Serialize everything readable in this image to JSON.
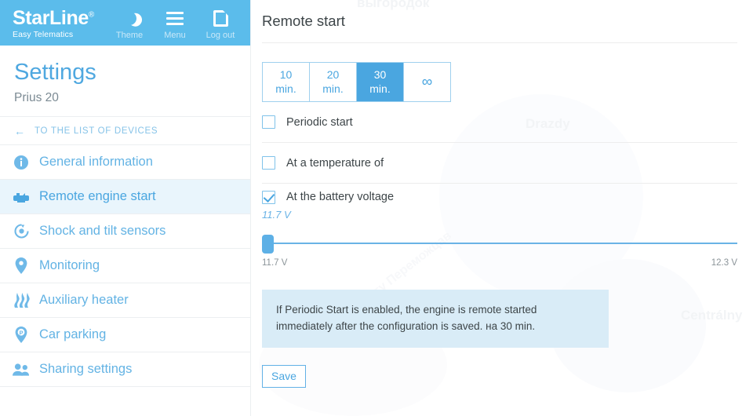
{
  "header": {
    "brand_name": "StarLine",
    "brand_tm": "®",
    "brand_sub": "Easy Telematics",
    "actions": [
      {
        "label": "Theme",
        "icon": "moon-icon"
      },
      {
        "label": "Menu",
        "icon": "hamburger-icon"
      },
      {
        "label": "Log out",
        "icon": "logout-door-icon"
      }
    ]
  },
  "sidebar": {
    "title": "Settings",
    "device": "Prius 20",
    "back_label": "TO THE LIST OF DEVICES",
    "back_arrow": "←",
    "items": [
      {
        "label": "General information",
        "icon": "info-icon",
        "active": false
      },
      {
        "label": "Remote engine start",
        "icon": "engine-icon",
        "active": true
      },
      {
        "label": "Shock and tilt sensors",
        "icon": "shock-sensor-icon",
        "active": false
      },
      {
        "label": "Monitoring",
        "icon": "map-pin-icon",
        "active": false
      },
      {
        "label": "Auxiliary heater",
        "icon": "heat-waves-icon",
        "active": false
      },
      {
        "label": "Car parking",
        "icon": "parking-pin-icon",
        "active": false
      },
      {
        "label": "Sharing settings",
        "icon": "users-icon",
        "active": false
      }
    ]
  },
  "main": {
    "page_title": "Remote start",
    "duration": {
      "options": [
        {
          "line1": "10",
          "line2": "min.",
          "active": false
        },
        {
          "line1": "20",
          "line2": "min.",
          "active": false
        },
        {
          "line1": "30",
          "line2": "min.",
          "active": true
        },
        {
          "line1": "∞",
          "line2": "",
          "active": false
        }
      ]
    },
    "checkboxes": [
      {
        "label": "Periodic start",
        "checked": false
      },
      {
        "label": "At a temperature of",
        "checked": false
      },
      {
        "label": "At the battery voltage",
        "checked": true
      }
    ],
    "voltage_value": "11.7 V",
    "slider": {
      "min_label": "11.7 V",
      "max_label": "12.3 V",
      "position_percent": 0
    },
    "info_text": "If Periodic Start is enabled, the engine is remote started immediately after the configuration is saved. на 30 min.",
    "save_label": "Save"
  },
  "watermarks": {
    "top": "выгородок",
    "drazdy": "Drazdy",
    "centralny": "Centrálny",
    "diagonal": "наспекту Переможцав"
  },
  "colors": {
    "brand_blue": "#5bbceb",
    "accent_blue": "#4aa6e0",
    "link_blue": "#63b3e4",
    "info_bg": "#d9ecf7",
    "active_nav_bg": "#e9f5fc"
  }
}
